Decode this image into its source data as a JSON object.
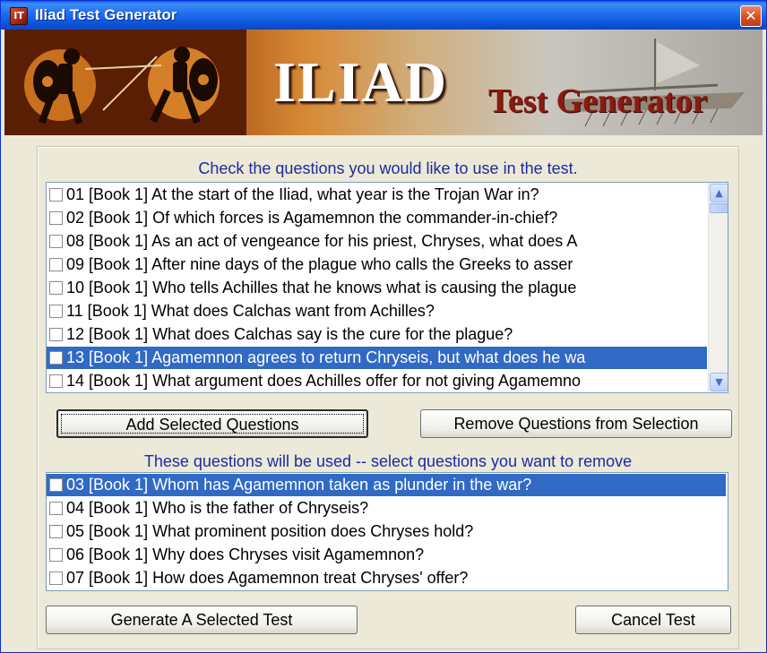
{
  "window": {
    "title": "Iliad Test Generator",
    "close_symbol": "✕",
    "app_icon_text": "IT"
  },
  "banner": {
    "title": "ILIAD",
    "subtitle": "Test Generator"
  },
  "available": {
    "heading": "Check the questions you would like to use in the test.",
    "items": [
      {
        "text": "01 [Book 1]  At the start of the Iliad, what year is the Trojan War in?",
        "selected": false
      },
      {
        "text": "02 [Book 1]  Of which forces is Agamemnon the commander-in-chief?",
        "selected": false
      },
      {
        "text": "08 [Book 1]  As an act of vengeance for his priest, Chryses, what does A",
        "selected": false
      },
      {
        "text": "09 [Book 1]  After nine days of the plague who calls the Greeks to asser",
        "selected": false
      },
      {
        "text": "10 [Book 1]  Who tells Achilles that he knows what is causing the plague",
        "selected": false
      },
      {
        "text": "11 [Book 1]  What does Calchas want from Achilles?",
        "selected": false
      },
      {
        "text": "12 [Book 1]  What does Calchas say is the cure for the plague?",
        "selected": false
      },
      {
        "text": "13 [Book 1]  Agamemnon agrees to return Chryseis, but what does he wa",
        "selected": true
      },
      {
        "text": "14 [Book 1]  What argument does Achilles offer for not giving Agamemno",
        "selected": false
      }
    ],
    "scroll_up": "▲",
    "scroll_down": "▼"
  },
  "buttons": {
    "add": "Add Selected Questions",
    "remove": "Remove Questions from Selection",
    "generate": "Generate A Selected Test",
    "cancel": "Cancel Test"
  },
  "selected": {
    "heading": "These questions will be used --  select questions you want to remove",
    "items": [
      {
        "text": "03 [Book 1]  Whom has Agamemnon taken as plunder in the war?",
        "selected": true
      },
      {
        "text": "04 [Book 1]  Who is the father of Chryseis?",
        "selected": false
      },
      {
        "text": "05 [Book 1]  What prominent position does Chryses hold?",
        "selected": false
      },
      {
        "text": "06 [Book 1]  Why does Chryses visit Agamemnon?",
        "selected": false
      },
      {
        "text": "07 [Book 1]  How does Agamemnon treat Chryses' offer?",
        "selected": false
      }
    ]
  }
}
